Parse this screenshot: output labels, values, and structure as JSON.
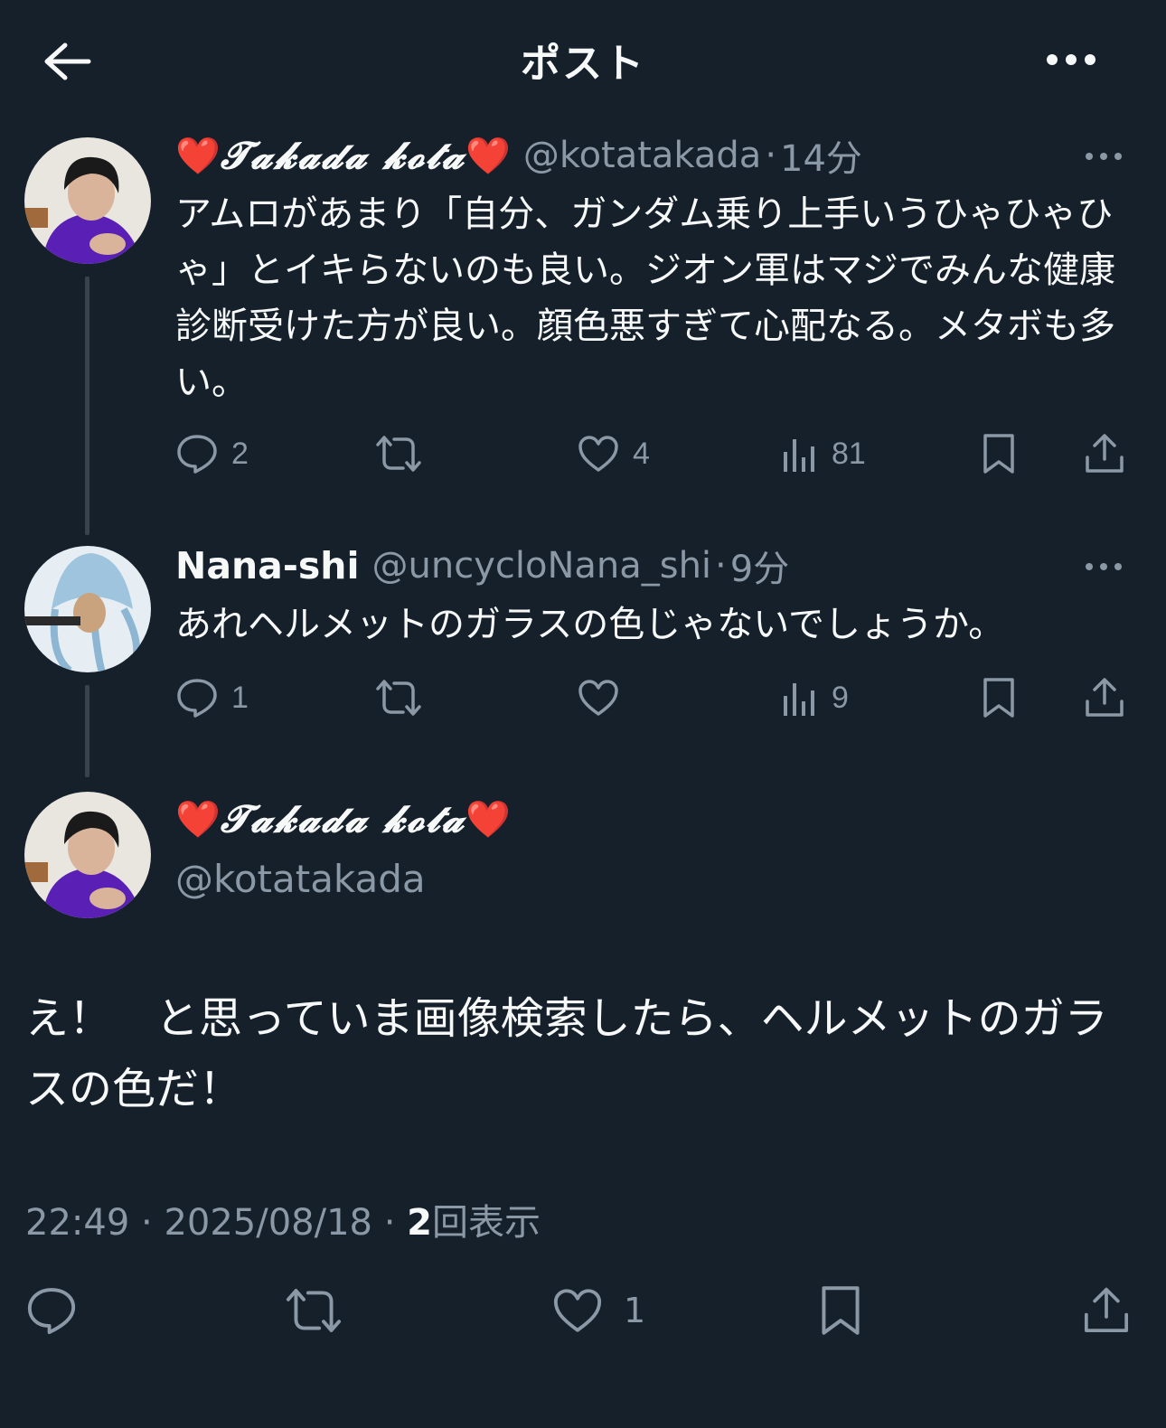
{
  "header": {
    "title": "ポスト"
  },
  "thread": [
    {
      "name": "𝓣𝓪𝓴𝓪𝓭𝓪 𝓴𝓸𝓽𝓪",
      "heart": "❤️",
      "handle": "@kotatakada",
      "sep": "·",
      "ago": "14分",
      "text": "アムロがあまり「自分、ガンダム乗り上手いうひゃひゃひゃ」とイキらないのも良い。ジオン軍はマジでみんな健康診断受けた方が良い。顔色悪すぎて心配なる。メタボも多い。",
      "replies": "2",
      "reposts": "",
      "likes": "4",
      "views": "81"
    },
    {
      "name": "Nana-shi",
      "handle": "@uncycloNana_shi",
      "sep": "·",
      "ago": "9分",
      "text": "あれヘルメットのガラスの色じゃないでしょうか。",
      "replies": "1",
      "reposts": "",
      "likes": "",
      "views": "9"
    }
  ],
  "main_tweet": {
    "name": "𝓣𝓪𝓴𝓪𝓭𝓪 𝓴𝓸𝓽𝓪",
    "heart": "❤️",
    "handle": "@kotatakada",
    "text": "え！　と思っていま画像検索したら、ヘルメットのガラスの色だ！",
    "time": "22:49",
    "sep": "·",
    "date": "2025/08/18",
    "view_count": "2",
    "view_label": "回表示",
    "likes": "1"
  },
  "icons": {
    "back": "arrow-left-icon",
    "more": "more-dots-icon",
    "reply": "reply-bubble-icon",
    "repost": "repost-arrows-icon",
    "like": "heart-outline-icon",
    "views": "bar-chart-icon",
    "bookmark": "bookmark-icon",
    "share": "share-upload-icon"
  },
  "colors": {
    "background": "#15202b",
    "text": "#f7f9f9",
    "secondary": "#8b98a5",
    "thread_line": "#38444d"
  }
}
